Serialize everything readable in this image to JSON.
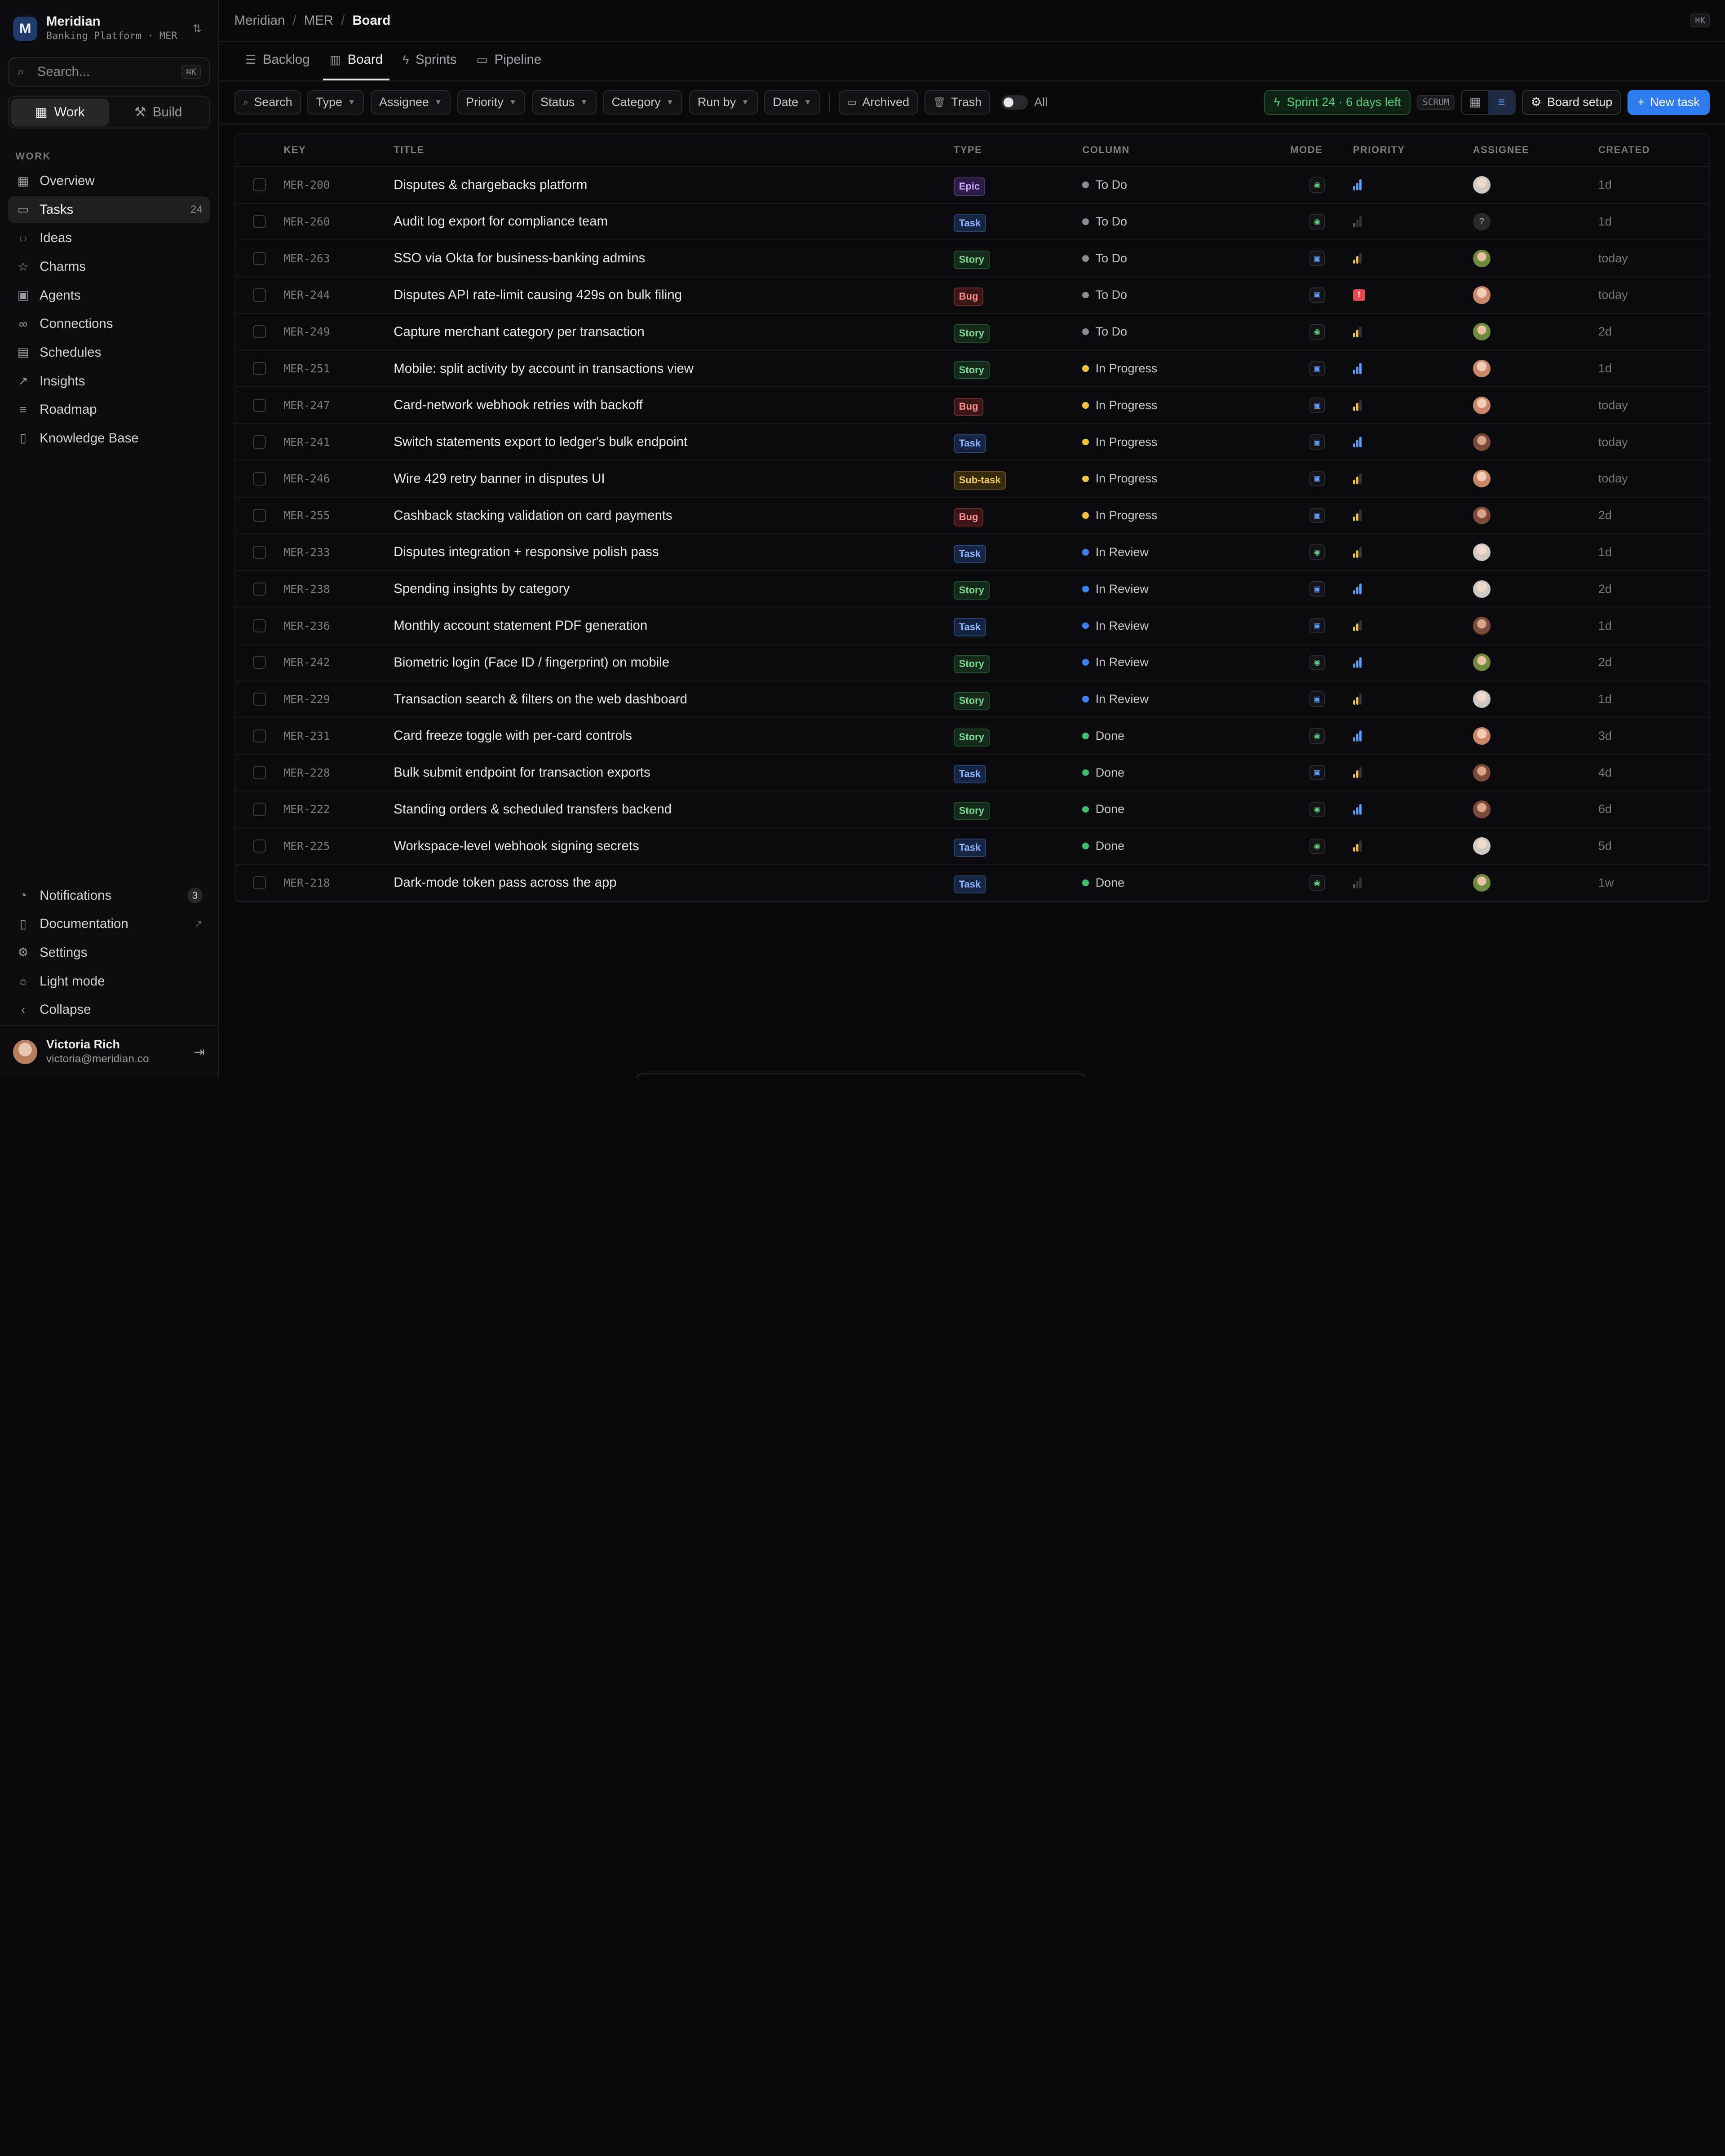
{
  "workspace": {
    "logo_letter": "M",
    "name": "Meridian",
    "subtitle": "Banking Platform · MER"
  },
  "sidebar": {
    "search_placeholder": "Search...",
    "search_shortcut": "⌘K",
    "segments": [
      {
        "label": "Work",
        "active": true
      },
      {
        "label": "Build",
        "active": false
      }
    ],
    "section_label": "WORK",
    "items": [
      {
        "label": "Overview",
        "icon": "grid-icon",
        "glyph": "▦"
      },
      {
        "label": "Tasks",
        "icon": "ticket-icon",
        "glyph": "▭",
        "count": "24",
        "active": true
      },
      {
        "label": "Ideas",
        "icon": "lightbulb-icon",
        "glyph": "◌"
      },
      {
        "label": "Charms",
        "icon": "star-icon",
        "glyph": "☆"
      },
      {
        "label": "Agents",
        "icon": "bot-icon",
        "glyph": "▣"
      },
      {
        "label": "Connections",
        "icon": "link-icon",
        "glyph": "∞"
      },
      {
        "label": "Schedules",
        "icon": "calendar-icon",
        "glyph": "▤"
      },
      {
        "label": "Insights",
        "icon": "trend-icon",
        "glyph": "↗"
      },
      {
        "label": "Roadmap",
        "icon": "roadmap-icon",
        "glyph": "≡"
      },
      {
        "label": "Knowledge Base",
        "icon": "book-icon",
        "glyph": "▯"
      }
    ],
    "bottom_items": [
      {
        "label": "Notifications",
        "icon": "bell-icon",
        "glyph": "◔",
        "count": "3"
      },
      {
        "label": "Documentation",
        "icon": "doc-icon",
        "glyph": "▯",
        "external": true
      },
      {
        "label": "Settings",
        "icon": "gear-icon",
        "glyph": "⚙"
      },
      {
        "label": "Light mode",
        "icon": "sun-icon",
        "glyph": "☼"
      },
      {
        "label": "Collapse",
        "icon": "chevron-left-icon",
        "glyph": "‹"
      }
    ],
    "user": {
      "name": "Victoria Rich",
      "email": "victoria@meridian.co"
    }
  },
  "topbar": {
    "crumbs": [
      "Meridian",
      "MER",
      "Board"
    ],
    "shortcut": "⌘K"
  },
  "tabs": [
    {
      "label": "Backlog",
      "icon": "list-icon",
      "glyph": "☰"
    },
    {
      "label": "Board",
      "icon": "board-icon",
      "glyph": "▥",
      "active": true
    },
    {
      "label": "Sprints",
      "icon": "bolt-icon",
      "glyph": "ϟ"
    },
    {
      "label": "Pipeline",
      "icon": "pipeline-icon",
      "glyph": "▭"
    }
  ],
  "filters": {
    "search_label": "Search",
    "dropdowns": [
      "Type",
      "Assignee",
      "Priority",
      "Status",
      "Category",
      "Run by",
      "Date"
    ],
    "archived_label": "Archived",
    "trash_label": "Trash",
    "toggle_label": "All",
    "sprint_label": "Sprint 24 ·  6 days left",
    "scrum_badge": "SCRUM",
    "setup_label": "Board setup",
    "new_task_label": "New task"
  },
  "colors": {
    "todo": "#8a8a90",
    "in_progress": "#f5c33b",
    "in_review": "#3b82f6",
    "done": "#3fbf6b",
    "priority_high": "#5a9cff",
    "priority_medium": "#f5c33b",
    "priority_low": "#5b5b62",
    "urgent": "#e5484d"
  },
  "table": {
    "headers": {
      "key": "KEY",
      "title": "TITLE",
      "type": "TYPE",
      "column": "COLUMN",
      "mode": "MODE",
      "priority": "PRIORITY",
      "assignee": "ASSIGNEE",
      "created": "CREATED"
    },
    "rows": [
      {
        "key": "MER-200",
        "title": "Disputes & chargebacks platform",
        "type": "Epic",
        "column": "To Do",
        "mode": "person",
        "priority": "high",
        "assignee": "a1",
        "created": "1d"
      },
      {
        "key": "MER-260",
        "title": "Audit log export for compliance team",
        "type": "Task",
        "column": "To Do",
        "mode": "person",
        "priority": "low",
        "assignee": "unassigned",
        "created": "1d"
      },
      {
        "key": "MER-263",
        "title": "SSO via Okta for business-banking admins",
        "type": "Story",
        "column": "To Do",
        "mode": "bot",
        "priority": "medium",
        "assignee": "a3",
        "created": "today"
      },
      {
        "key": "MER-244",
        "title": "Disputes API rate-limit causing 429s on bulk filing",
        "type": "Bug",
        "column": "To Do",
        "mode": "bot",
        "priority": "urgent",
        "assignee": "a2",
        "created": "today"
      },
      {
        "key": "MER-249",
        "title": "Capture merchant category per transaction",
        "type": "Story",
        "column": "To Do",
        "mode": "person",
        "priority": "medium",
        "assignee": "a3",
        "created": "2d"
      },
      {
        "key": "MER-251",
        "title": "Mobile: split activity by account in transactions view",
        "type": "Story",
        "column": "In Progress",
        "mode": "bot",
        "priority": "high",
        "assignee": "a2",
        "created": "1d"
      },
      {
        "key": "MER-247",
        "title": "Card-network webhook retries with backoff",
        "type": "Bug",
        "column": "In Progress",
        "mode": "bot",
        "priority": "medium",
        "assignee": "a2",
        "created": "today"
      },
      {
        "key": "MER-241",
        "title": "Switch statements export to ledger's bulk endpoint",
        "type": "Task",
        "column": "In Progress",
        "mode": "bot",
        "priority": "high",
        "assignee": "a4",
        "created": "today"
      },
      {
        "key": "MER-246",
        "title": "Wire 429 retry banner in disputes UI",
        "type": "Sub-task",
        "column": "In Progress",
        "mode": "bot",
        "priority": "medium",
        "assignee": "a2",
        "created": "today"
      },
      {
        "key": "MER-255",
        "title": "Cashback stacking validation on card payments",
        "type": "Bug",
        "column": "In Progress",
        "mode": "bot",
        "priority": "medium",
        "assignee": "a4",
        "created": "2d"
      },
      {
        "key": "MER-233",
        "title": "Disputes integration + responsive polish pass",
        "type": "Task",
        "column": "In Review",
        "mode": "person",
        "priority": "medium",
        "assignee": "a1",
        "created": "1d"
      },
      {
        "key": "MER-238",
        "title": "Spending insights by category",
        "type": "Story",
        "column": "In Review",
        "mode": "bot",
        "priority": "high",
        "assignee": "a1",
        "created": "2d"
      },
      {
        "key": "MER-236",
        "title": "Monthly account statement PDF generation",
        "type": "Task",
        "column": "In Review",
        "mode": "bot",
        "priority": "medium",
        "assignee": "a4",
        "created": "1d"
      },
      {
        "key": "MER-242",
        "title": "Biometric login (Face ID / fingerprint) on mobile",
        "type": "Story",
        "column": "In Review",
        "mode": "person",
        "priority": "high",
        "assignee": "a3",
        "created": "2d"
      },
      {
        "key": "MER-229",
        "title": "Transaction search & filters on the web dashboard",
        "type": "Story",
        "column": "In Review",
        "mode": "bot",
        "priority": "medium",
        "assignee": "a1",
        "created": "1d"
      },
      {
        "key": "MER-231",
        "title": "Card freeze toggle with per-card controls",
        "type": "Story",
        "column": "Done",
        "mode": "person",
        "priority": "high",
        "assignee": "a2",
        "created": "3d"
      },
      {
        "key": "MER-228",
        "title": "Bulk submit endpoint for transaction exports",
        "type": "Task",
        "column": "Done",
        "mode": "bot",
        "priority": "medium",
        "assignee": "a4",
        "created": "4d"
      },
      {
        "key": "MER-222",
        "title": "Standing orders & scheduled transfers backend",
        "type": "Story",
        "column": "Done",
        "mode": "person",
        "priority": "high",
        "assignee": "a4",
        "created": "6d"
      },
      {
        "key": "MER-225",
        "title": "Workspace-level webhook signing secrets",
        "type": "Task",
        "column": "Done",
        "mode": "person",
        "priority": "medium",
        "assignee": "a1",
        "created": "5d"
      },
      {
        "key": "MER-218",
        "title": "Dark-mode token pass across the app",
        "type": "Task",
        "column": "Done",
        "mode": "person",
        "priority": "low",
        "assignee": "a3",
        "created": "1w"
      }
    ]
  }
}
